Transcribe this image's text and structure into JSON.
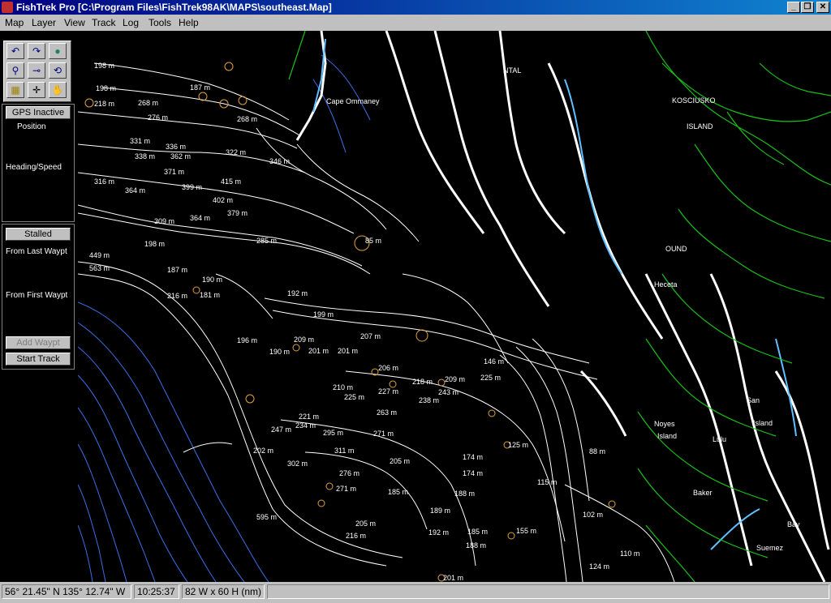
{
  "window": {
    "title": "FishTrek Pro [C:\\Program Files\\FishTrek98AK\\MAPS\\southeast.Map]",
    "minimize_glyph": "_",
    "restore_glyph": "❐",
    "close_glyph": "✕"
  },
  "menu": [
    "Map",
    "Layer",
    "View",
    "Track",
    "Log",
    "Tools",
    "Help"
  ],
  "tools": [
    {
      "icon": "undo-icon",
      "glyph": "↶"
    },
    {
      "icon": "redo-icon",
      "glyph": "↷"
    },
    {
      "icon": "globe-icon",
      "glyph": "●"
    },
    {
      "icon": "zoom-icon",
      "glyph": "⚲"
    },
    {
      "icon": "measure-icon",
      "glyph": "⊸"
    },
    {
      "icon": "refresh-icon",
      "glyph": "⟲"
    },
    {
      "icon": "grid-icon",
      "glyph": "▦"
    },
    {
      "icon": "crosshair-icon",
      "glyph": "✛"
    },
    {
      "icon": "hand-icon",
      "glyph": "✋"
    }
  ],
  "gps": {
    "status_button": "GPS Inactive",
    "position_label": "Position",
    "heading_label": "Heading/Speed"
  },
  "track": {
    "status_button": "Stalled",
    "from_last_label": "From Last Waypt",
    "from_first_label": "From First Waypt",
    "add_waypt_button": "Add Waypt",
    "start_track_button": "Start Track"
  },
  "map": {
    "colors": {
      "water": "#000000",
      "deep_contour": "#3a6fe8",
      "contour": "#ffffff",
      "coast": "#ffffff",
      "land": "#18c018",
      "shallow": "#60c0ff",
      "marker": "#e0a040"
    },
    "places": [
      "Cape Ommaney",
      "KOSCIUSKO",
      "ISLAND",
      "Heceta",
      "Noyes",
      "Island",
      "Lulu",
      "San",
      "Island",
      "Baker",
      "Suemez",
      "Bay",
      "NTAL",
      "OUND"
    ],
    "depths": [
      "198 m",
      "198 m",
      "187 m",
      "218 m",
      "268 m",
      "276 m",
      "268 m",
      "331 m",
      "336 m",
      "338 m",
      "362 m",
      "322 m",
      "346 m",
      "371 m",
      "316 m",
      "399 m",
      "415 m",
      "364 m",
      "402 m",
      "379 m",
      "309 m",
      "364 m",
      "198 m",
      "187 m",
      "190 m",
      "181 m",
      "216 m",
      "192 m",
      "199 m",
      "207 m",
      "209 m",
      "196 m",
      "190 m",
      "201 m",
      "201 m",
      "206 m",
      "218 m",
      "209 m",
      "210 m",
      "225 m",
      "227 m",
      "243 m",
      "238 m",
      "146 m",
      "225 m",
      "221 m",
      "234 m",
      "247 m",
      "263 m",
      "271 m",
      "295 m",
      "311 m",
      "302 m",
      "276 m",
      "271 m",
      "205 m",
      "185 m",
      "189 m",
      "188 m",
      "192 m",
      "185 m",
      "188 m",
      "205 m",
      "216 m",
      "202 m",
      "595 m",
      "174 m",
      "174 m",
      "125 m",
      "115 m",
      "102 m",
      "88 m",
      "155 m",
      "110 m",
      "124 m",
      "201 m",
      "563 m",
      "449 m",
      "285 m",
      "85 m"
    ]
  },
  "status": {
    "coords": "56° 21.45\" N 135° 12.74\" W",
    "time": "10:25:37",
    "extent": "82 W x 60 H (nm)"
  }
}
